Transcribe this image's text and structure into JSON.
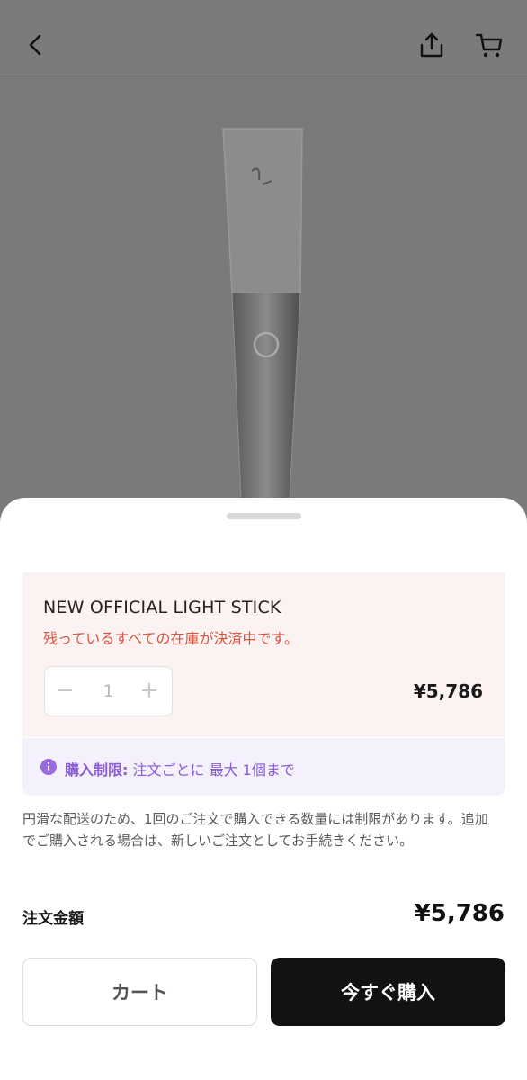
{
  "header": {
    "back_icon": "chevron-left-icon",
    "share_icon": "share-icon",
    "cart_icon": "cart-icon"
  },
  "product": {
    "image": "light-stick-product-image"
  },
  "sheet": {
    "item": {
      "name": "NEW OFFICIAL LIGHT STICK",
      "warning": "残っているすべての在庫が決済中です。",
      "quantity": "1",
      "price": "¥5,786"
    },
    "limit": {
      "label": "購入制限:",
      "text": "注文ごとに 最大 1個まで",
      "accent_color": "#8a5cd6"
    },
    "note": "円滑な配送のため、1回のご注文で購入できる数量には制限があります。追加でご購入される場合は、新しいご注文としてお手続きください。",
    "total": {
      "label": "注文金額",
      "price": "¥5,786"
    },
    "buttons": {
      "cart": "カート",
      "buy_now": "今すぐ購入"
    }
  }
}
